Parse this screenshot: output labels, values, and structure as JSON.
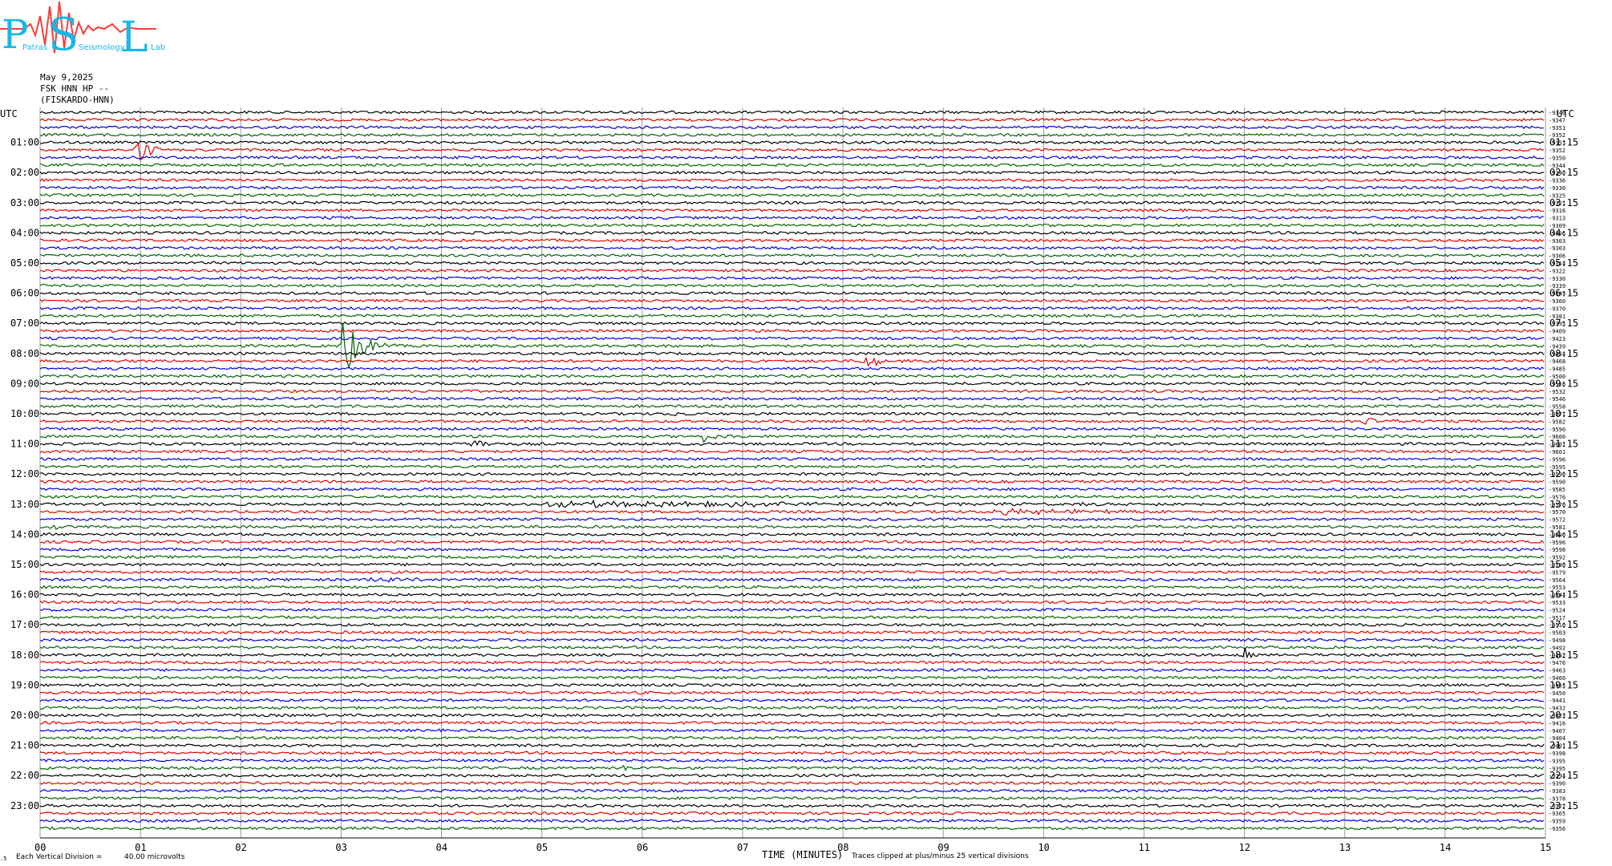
{
  "logo": {
    "letters": [
      "P",
      "S",
      "L"
    ],
    "subtitle_words": [
      "Patras",
      "Seismology",
      "Lab"
    ],
    "colors": {
      "text": "#19b6e8",
      "wave": "#ff3b3b"
    }
  },
  "header": {
    "date": "May 9,2025",
    "channel": "FSK HNN HP --",
    "station": "(FISKARDO-HNN)"
  },
  "footer": {
    "corner_mark": ".5",
    "vertical_division": "Each Vertical Division =",
    "microvolts": "40.00 microvolts",
    "time_label": "TIME (MINUTES)",
    "clipped_note": "Traces clipped at plus/minus 25 vertical divisions"
  },
  "chart_data": {
    "type": "line",
    "title": "",
    "xlabel": "TIME (MINUTES)",
    "ylabel": "UTC",
    "x_ticks": [
      "00",
      "01",
      "02",
      "03",
      "04",
      "05",
      "06",
      "07",
      "08",
      "09",
      "10",
      "11",
      "12",
      "13",
      "14",
      "15"
    ],
    "xlim": [
      0,
      15
    ],
    "left_axis_label": "UTC",
    "right_axis_label": "UTC",
    "left_hour_labels": [
      "01:00",
      "02:00",
      "03:00",
      "04:00",
      "05:00",
      "06:00",
      "07:00",
      "08:00",
      "09:00",
      "10:00",
      "11:00",
      "12:00",
      "13:00",
      "14:00",
      "15:00",
      "16:00",
      "17:00",
      "18:00",
      "19:00",
      "20:00",
      "21:00",
      "22:00",
      "23:00"
    ],
    "right_hour_labels": [
      "01:15",
      "02:15",
      "03:15",
      "04:15",
      "05:15",
      "06:15",
      "07:15",
      "08:15",
      "09:15",
      "10:15",
      "11:15",
      "12:15",
      "13:15",
      "14:15",
      "15:15",
      "16:15",
      "17:15",
      "18:15",
      "19:15",
      "20:15",
      "21:15",
      "22:15",
      "23:15"
    ],
    "trace_colors": [
      "#000000",
      "#e00000",
      "#0000e0",
      "#006400"
    ],
    "traces_per_hour": 4,
    "minutes_per_trace": 15,
    "offsets": [
      "-9340",
      "-9347",
      "-9351",
      "-9352",
      "-9353",
      "-9352",
      "-9350",
      "-9344",
      "-9340",
      "-9336",
      "-9330",
      "-9325",
      "-9321",
      "-9316",
      "-9313",
      "-9309",
      "-9306",
      "-9303",
      "-9303",
      "-9306",
      "-9314",
      "-9322",
      "-9330",
      "-9339",
      "-9349",
      "-9360",
      "-9370",
      "-9381",
      "-9395",
      "-9409",
      "-9423",
      "-9439",
      "-9454",
      "-9468",
      "-9485",
      "-9500",
      "-9516",
      "-9532",
      "-9546",
      "-9558",
      "-9571",
      "-9582",
      "-9590",
      "-9600",
      "-9601",
      "-9601",
      "-9596",
      "-9595",
      "-9590",
      "-9590",
      "-9585",
      "-9576",
      "-9570",
      "-9570",
      "-9572",
      "-9581",
      "-9590",
      "-9596",
      "-9598",
      "-9592",
      "-9590",
      "-9579",
      "-9564",
      "-9553",
      "-9544",
      "-9533",
      "-9524",
      "-9517",
      "-9510",
      "-9503",
      "-9498",
      "-9492",
      "-9482",
      "-9476",
      "-9463",
      "-9460",
      "-9455",
      "-9450",
      "-9441",
      "-9432",
      "-9423",
      "-9416",
      "-9407",
      "-9404",
      "-9401",
      "-9398",
      "-9395",
      "-9395",
      "-9394",
      "-9390",
      "-9383",
      "-9378",
      "-9372",
      "-9365",
      "-9359",
      "-9356"
    ],
    "events": [
      {
        "trace": 5,
        "minute": 0.95,
        "amplitude": 30,
        "duration_min": 0.35
      },
      {
        "trace": 31,
        "minute": 3.0,
        "amplitude": 40,
        "duration_min": 0.55
      },
      {
        "trace": 33,
        "minute": 8.2,
        "amplitude": 10,
        "duration_min": 0.5
      },
      {
        "trace": 40,
        "minute": 6.3,
        "amplitude": 5,
        "duration_min": 0.15
      },
      {
        "trace": 41,
        "minute": 13.2,
        "amplitude": 6,
        "duration_min": 0.6
      },
      {
        "trace": 43,
        "minute": 6.6,
        "amplitude": 8,
        "duration_min": 0.3
      },
      {
        "trace": 44,
        "minute": 4.3,
        "amplitude": 10,
        "duration_min": 0.3
      },
      {
        "trace": 52,
        "minute": 5.0,
        "amplitude": 4,
        "duration_min": 9.5
      },
      {
        "trace": 53,
        "minute": 9.5,
        "amplitude": 4,
        "duration_min": 3.5
      },
      {
        "trace": 55,
        "minute": 0.1,
        "amplitude": 5,
        "duration_min": 0.4
      },
      {
        "trace": 59,
        "minute": 6.8,
        "amplitude": 7,
        "duration_min": 0.2
      },
      {
        "trace": 62,
        "minute": 3.3,
        "amplitude": 4,
        "duration_min": 1.3
      },
      {
        "trace": 72,
        "minute": 12.0,
        "amplitude": 12,
        "duration_min": 0.1
      },
      {
        "trace": 87,
        "minute": 5.8,
        "amplitude": 6,
        "duration_min": 0.3
      }
    ]
  }
}
